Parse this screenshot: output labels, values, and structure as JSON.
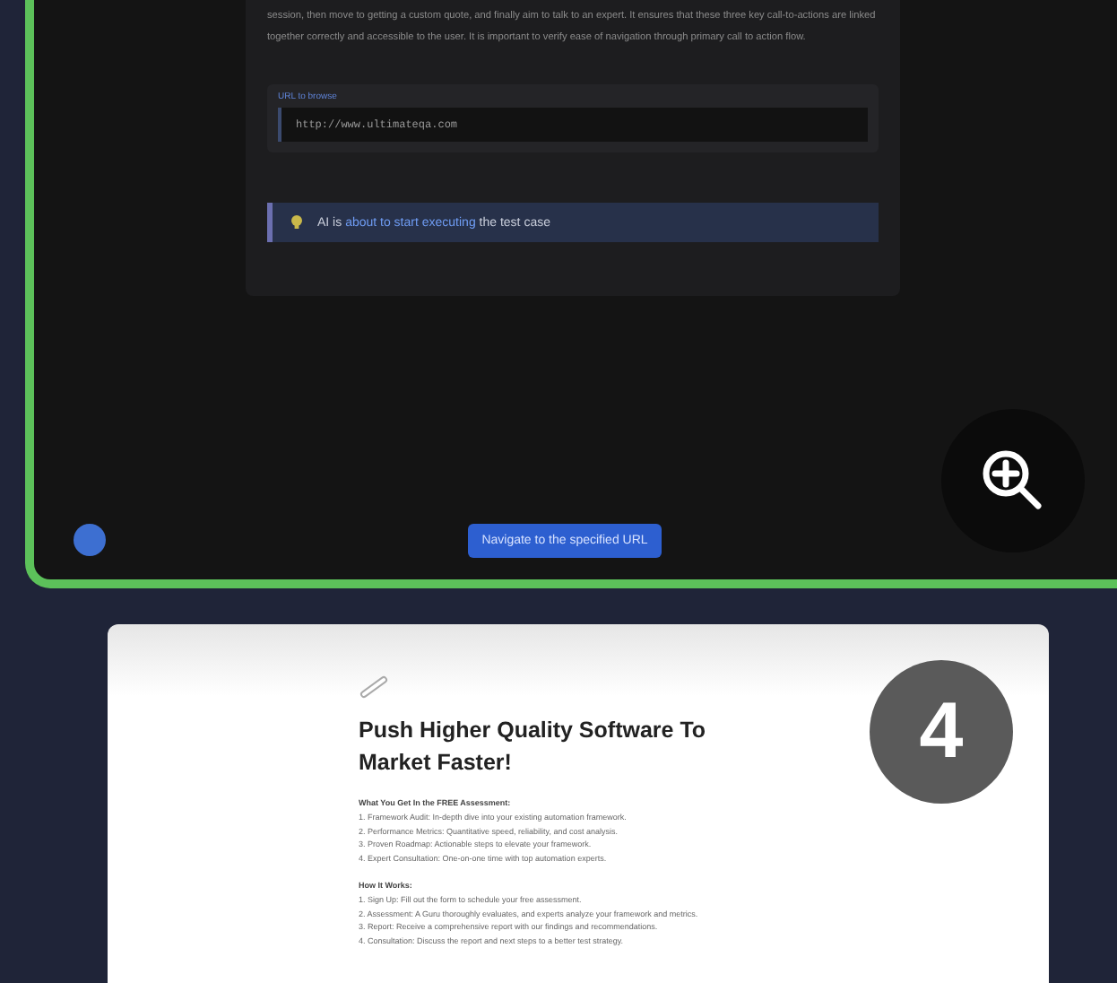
{
  "step_card": {
    "description": "session, then move to getting a custom quote, and finally aim to talk to an expert. It ensures that these three key call-to-actions are linked together correctly and accessible to the user. It is important to verify ease of navigation through primary call to action flow.",
    "url_field": {
      "label": "URL to browse",
      "value": "http://www.ultimateqa.com"
    },
    "status": {
      "prefix": "AI is ",
      "highlight": "about to start executing",
      "suffix": " the test case"
    },
    "action_button": "Navigate to the specified URL"
  },
  "next_card": {
    "badge": "4",
    "heading": "Push Higher Quality Software To Market Faster!",
    "sections": [
      {
        "title": "What You Get In the FREE Assessment:",
        "items": [
          "1. Framework Audit: In-depth dive into your existing automation framework.",
          "2. Performance Metrics: Quantitative speed, reliability, and cost analysis.",
          "3. Proven Roadmap: Actionable steps to elevate your framework.",
          "4. Expert Consultation: One-on-one time with top automation experts."
        ]
      },
      {
        "title": "How It Works:",
        "items": [
          "1. Sign Up: Fill out the form to schedule your free assessment.",
          "2. Assessment: A Guru thoroughly evaluates, and experts analyze your framework and metrics.",
          "3. Report: Receive a comprehensive report with our findings and recommendations.",
          "4. Consultation: Discuss the report and next steps to a better test strategy."
        ]
      }
    ]
  }
}
